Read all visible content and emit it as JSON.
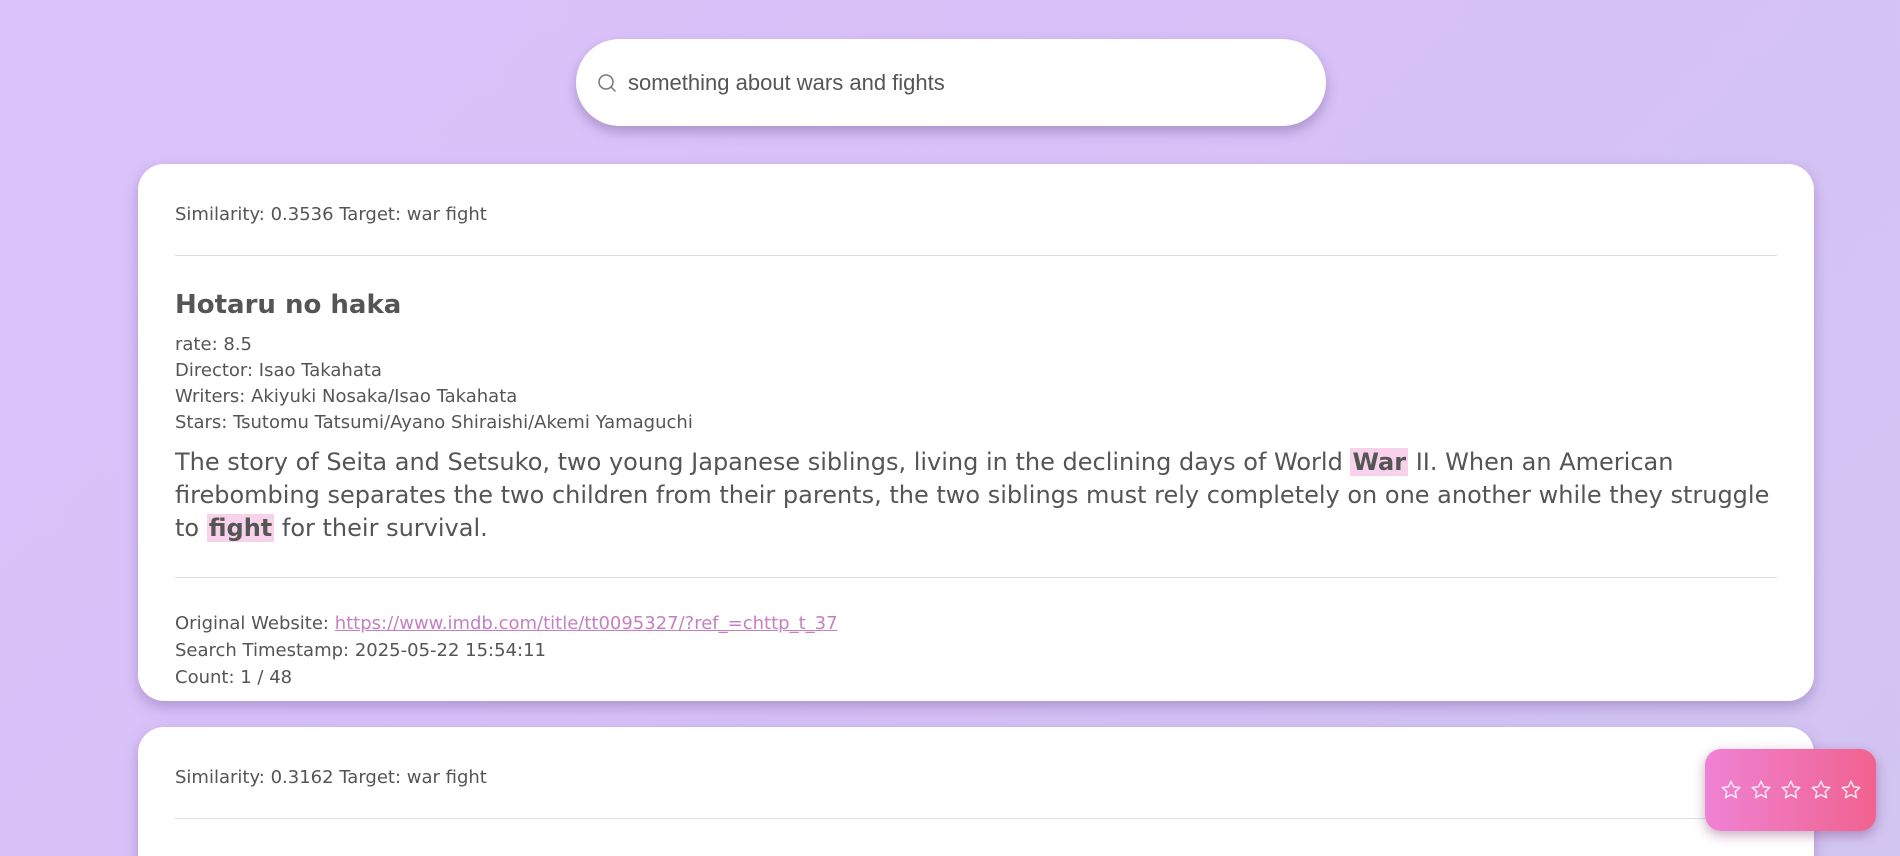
{
  "search": {
    "icon": "search-icon",
    "value": "something about wars and fights"
  },
  "results": [
    {
      "meta": "Similarity: 0.3536 Target: war fight",
      "title": "Hotaru no haka",
      "rate": "rate: 8.5",
      "director": "Director: Isao Takahata",
      "writers": "Writers: Akiyuki Nosaka/Isao Takahata",
      "stars": "Stars: Tsutomu Tatsumi/Ayano Shiraishi/Akemi Yamaguchi",
      "description": {
        "part1": "The story of Seita and Setsuko, two young Japanese siblings, living in the declining days of World ",
        "highlight1": "War",
        "part2": " II. When an American firebombing separates the two children from their parents, the two siblings must rely completely on one another while they struggle to ",
        "highlight2": "fight",
        "part3": " for their survival."
      },
      "website_label": "Original Website: ",
      "website_url": "https://www.imdb.com/title/tt0095327/?ref_=chttp_t_37",
      "timestamp": "Search Timestamp: 2025-05-22 15:54:11",
      "count": "Count: 1 / 48"
    },
    {
      "meta": "Similarity: 0.3162 Target: war fight"
    }
  ],
  "rating_widget": {
    "star_count": 5,
    "selected": 0,
    "icon": "star-outline-icon",
    "colors": [
      "#ef82d4",
      "#f1628f"
    ]
  },
  "colors": {
    "highlight": "#f7d2ea",
    "link": "#c67fc0",
    "background": "#dcc2fb"
  }
}
